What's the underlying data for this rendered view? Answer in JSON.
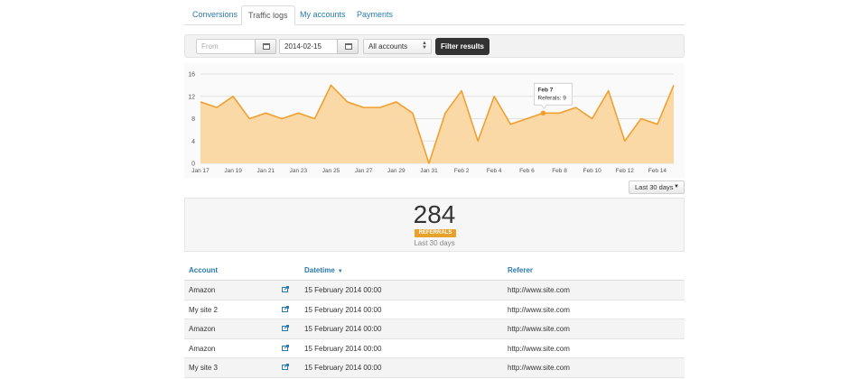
{
  "tabs": [
    {
      "label": "Conversions",
      "active": false
    },
    {
      "label": "Traffic logs",
      "active": true
    },
    {
      "label": "My accounts",
      "active": false
    },
    {
      "label": "Payments",
      "active": false
    }
  ],
  "filters": {
    "from_placeholder": "From",
    "to_value": "2014-02-15",
    "account_select": "All accounts",
    "filter_button": "Filter results"
  },
  "chart_data": {
    "type": "area",
    "x": [
      "Jan 17",
      "Jan 18",
      "Jan 19",
      "Jan 20",
      "Jan 21",
      "Jan 22",
      "Jan 23",
      "Jan 24",
      "Jan 25",
      "Jan 26",
      "Jan 27",
      "Jan 28",
      "Jan 29",
      "Jan 30",
      "Jan 31",
      "Feb 1",
      "Feb 2",
      "Feb 3",
      "Feb 4",
      "Feb 5",
      "Feb 6",
      "Feb 7",
      "Feb 8",
      "Feb 9",
      "Feb 10",
      "Feb 11",
      "Feb 12",
      "Feb 13",
      "Feb 14",
      "Feb 15"
    ],
    "values": [
      11,
      10,
      12,
      8,
      9,
      8,
      9,
      8,
      14,
      11,
      10,
      10,
      11,
      9,
      0,
      9,
      13,
      4,
      12,
      7,
      8,
      9,
      9,
      10,
      8,
      13,
      4,
      8,
      7,
      14
    ],
    "x_tick_labels": [
      "Jan 17",
      "Jan 19",
      "Jan 21",
      "Jan 23",
      "Jan 25",
      "Jan 27",
      "Jan 29",
      "Jan 31",
      "Feb 2",
      "Feb 4",
      "Feb 6",
      "Feb 8",
      "Feb 10",
      "Feb 12",
      "Feb 14"
    ],
    "y_ticks": [
      0,
      4,
      8,
      12,
      16
    ],
    "ylim": [
      0,
      16
    ],
    "grid": true,
    "colors": {
      "line": "#f0a030",
      "fill": "#fbd9a6"
    },
    "tooltip": {
      "title": "Feb 7",
      "text": "Referals: 9",
      "index": 21
    }
  },
  "range_select": "Last 30 days",
  "stats": {
    "count": "284",
    "badge": "REFERRALS",
    "period": "Last 30 days"
  },
  "table": {
    "headers": {
      "account": "Account",
      "datetime": "Datetime",
      "referer": "Referer"
    },
    "rows": [
      {
        "account": "Amazon",
        "datetime": "15 February 2014 00:00",
        "referer": "http://www.site.com"
      },
      {
        "account": "My site 2",
        "datetime": "15 February 2014 00:00",
        "referer": "http://www.site.com"
      },
      {
        "account": "Amazon",
        "datetime": "15 February 2014 00:00",
        "referer": "http://www.site.com"
      },
      {
        "account": "Amazon",
        "datetime": "15 February 2014 00:00",
        "referer": "http://www.site.com"
      },
      {
        "account": "My site 3",
        "datetime": "15 February 2014 00:00",
        "referer": "http://www.site.com"
      }
    ]
  }
}
